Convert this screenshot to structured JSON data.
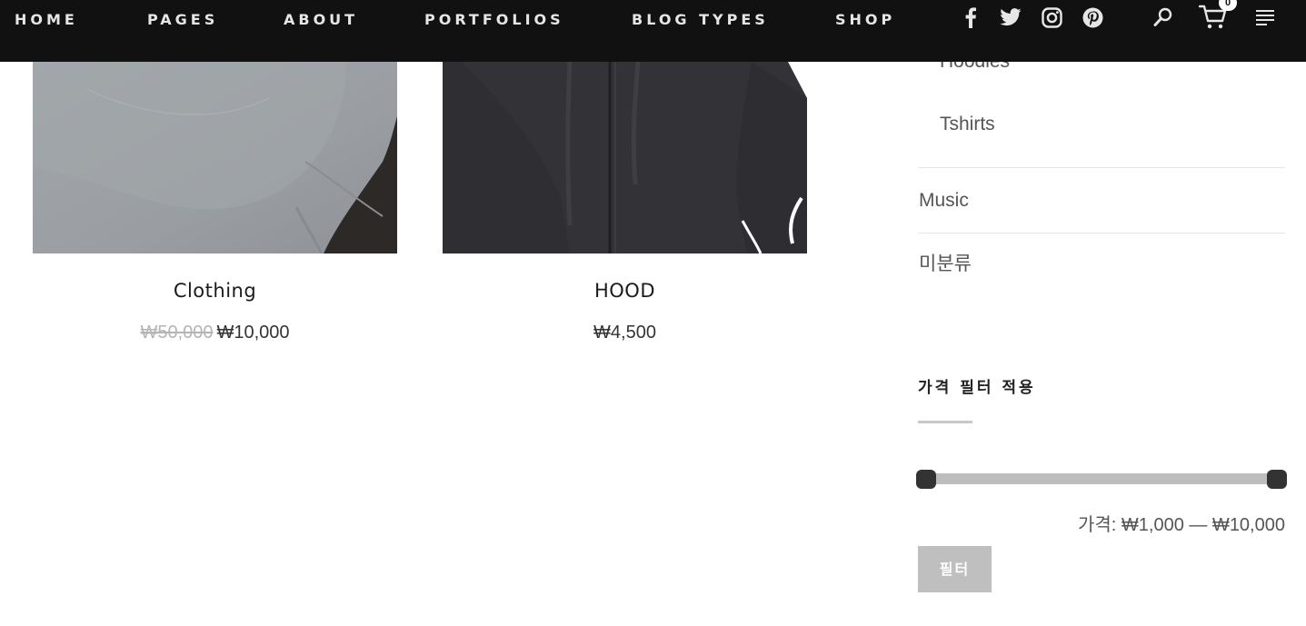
{
  "nav": {
    "items": [
      {
        "label": "HOME"
      },
      {
        "label": "PAGES"
      },
      {
        "label": "ABOUT"
      },
      {
        "label": "PORTFOLIOS"
      },
      {
        "label": "BLOG TYPES"
      },
      {
        "label": "SHOP"
      }
    ],
    "social_icons": [
      "facebook-icon",
      "twitter-icon",
      "instagram-icon",
      "pinterest-icon"
    ],
    "cart_count": "0"
  },
  "products": [
    {
      "title": "Clothing",
      "price_old": "₩50,000",
      "price_new": "₩10,000",
      "image": "gray-tshirt"
    },
    {
      "title": "HOOD",
      "price_new": "₩4,500",
      "image": "black-zip-hoodie"
    }
  ],
  "sidebar": {
    "categories": [
      {
        "label": "Hoodies"
      },
      {
        "label": "Tshirts"
      },
      {
        "label": "Music"
      },
      {
        "label": "미분류"
      }
    ],
    "price_filter": {
      "title": "가격 필터 적용",
      "label": "가격: ₩1,000 — ₩10,000",
      "min": 1000,
      "max": 10000,
      "button_label": "필터"
    }
  },
  "colors": {
    "topbar": "#111111",
    "slider_track": "#bdbdbd",
    "slider_handle": "#333333",
    "filter_button": "#bfbfbf"
  }
}
